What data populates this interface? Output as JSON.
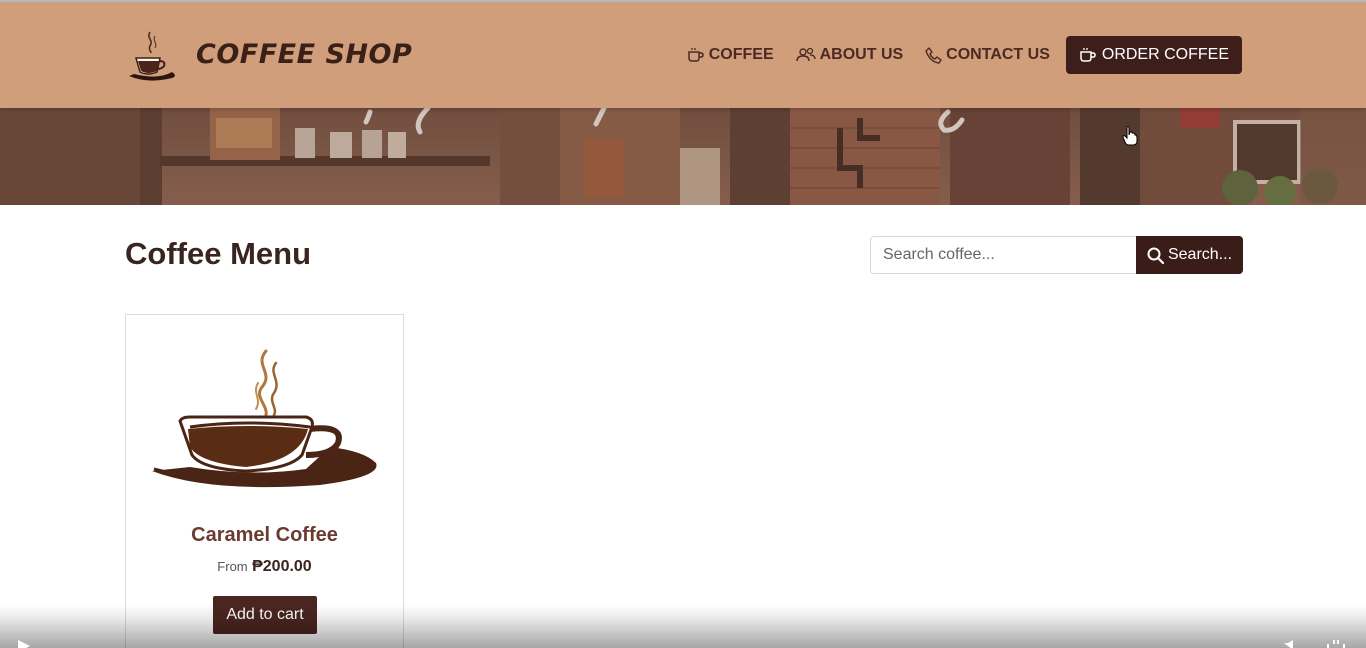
{
  "header": {
    "brand_name": "COFFEE SHOP",
    "nav": [
      {
        "label": "COFFEE",
        "icon": "coffee-cup-icon"
      },
      {
        "label": "ABOUT US",
        "icon": "users-icon"
      },
      {
        "label": "CONTACT US",
        "icon": "phone-icon"
      }
    ],
    "order_button": {
      "label": "ORDER COFFEE",
      "icon": "coffee-cup-icon"
    }
  },
  "main": {
    "title": "Coffee Menu",
    "search": {
      "placeholder": "Search coffee...",
      "value": "",
      "button_label": "Search...",
      "icon": "search-icon"
    },
    "products": [
      {
        "name": "Caramel Coffee",
        "price_prefix": "From",
        "price": "₱200.00",
        "button_label": "Add to cart",
        "image": "coffee-cup-image"
      }
    ]
  },
  "colors": {
    "header_bg": "#d19e7b",
    "brand_dark": "#3a1c18",
    "product_name": "#6b3b30"
  }
}
